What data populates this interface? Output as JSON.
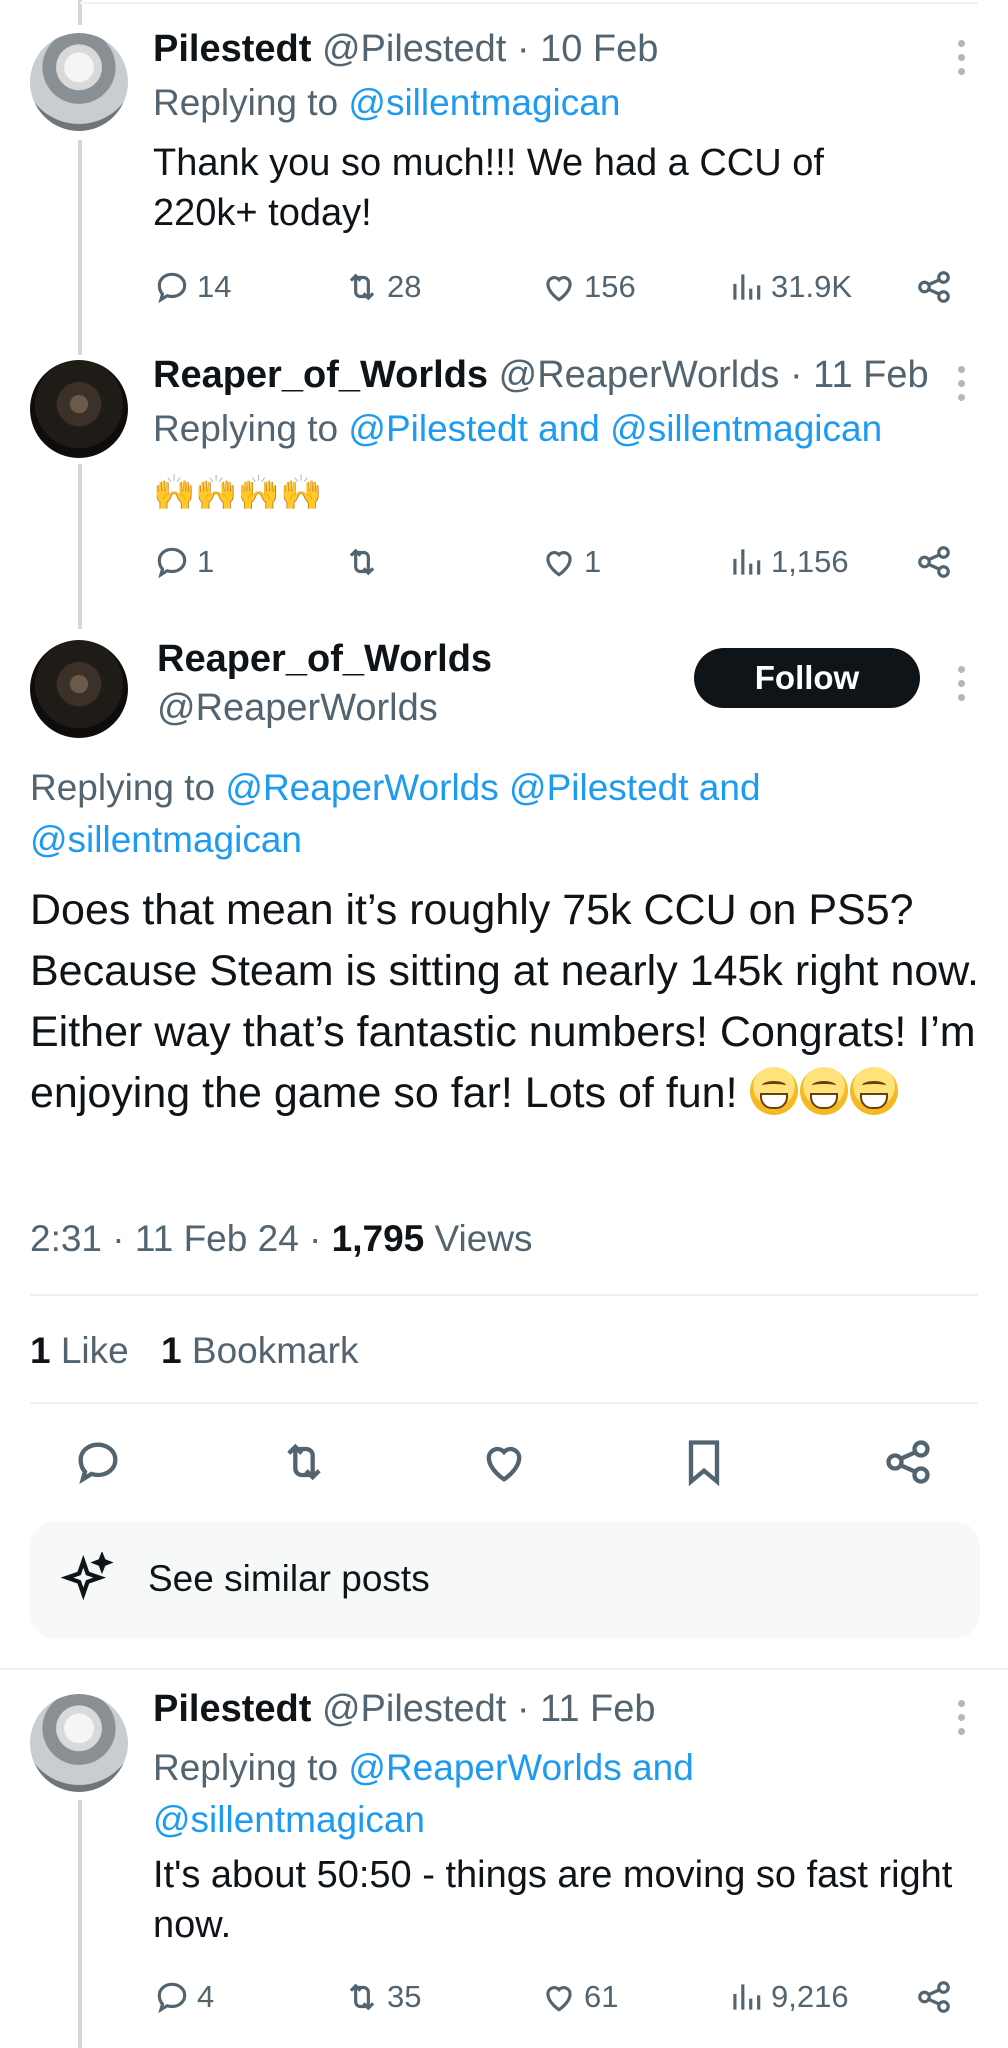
{
  "tweet1": {
    "name": "Pilestedt",
    "handle": "@Pilestedt",
    "date": "· 10 Feb",
    "replying_prefix": "Replying to",
    "replying_to": "@sillentmagican",
    "text": "Thank you so much!!! We had a  CCU of 220k+ today!",
    "replies": "14",
    "reposts": "28",
    "likes": "156",
    "views": "31.9K"
  },
  "tweet2": {
    "name": "Reaper_of_Worlds",
    "handle": "@ReaperWorlds",
    "date": "· 11 Feb",
    "replying_prefix": "Replying to",
    "replying_to": "@Pilestedt and @sillentmagican",
    "emoji_text": "🙌🙌🙌🙌",
    "replies": "1",
    "likes": "1",
    "views": "1,156"
  },
  "main": {
    "name": "Reaper_of_Worlds",
    "handle": "@ReaperWorlds",
    "follow_label": "Follow",
    "replying_prefix": "Replying to",
    "replying_to_1": "@ReaperWorlds @Pilestedt and",
    "replying_to_2": "@sillentmagican",
    "text": "Does that mean it’s roughly 75k CCU on PS5? Because Steam is sitting at nearly 145k right now. Either way that’s fantastic numbers! Congrats! I’m enjoying the game so far! Lots of fun!",
    "timestamp": "2:31 · 11 Feb 24 ·",
    "views_count": "1,795",
    "views_label": "Views",
    "likes_count": "1",
    "likes_label": "Like",
    "bookmarks_count": "1",
    "bookmarks_label": "Bookmark",
    "similar_label": "See similar posts"
  },
  "tweet3": {
    "name": "Pilestedt",
    "handle": "@Pilestedt",
    "date": "· 11 Feb",
    "replying_prefix": "Replying to",
    "replying_to_1": "@ReaperWorlds and",
    "replying_to_2": "@sillentmagican",
    "text": "It's about 50:50 - things are moving so fast right now.",
    "replies": "4",
    "reposts": "35",
    "likes": "61",
    "views": "9,216"
  },
  "colors": {
    "link": "#1d9bf0",
    "muted": "#536471",
    "text": "#0f1419",
    "follow_bg": "#0f1419"
  },
  "icons": [
    "reply-icon",
    "repost-icon",
    "like-icon",
    "views-icon",
    "share-icon",
    "bookmark-icon",
    "sparkle-icon",
    "more-icon"
  ]
}
